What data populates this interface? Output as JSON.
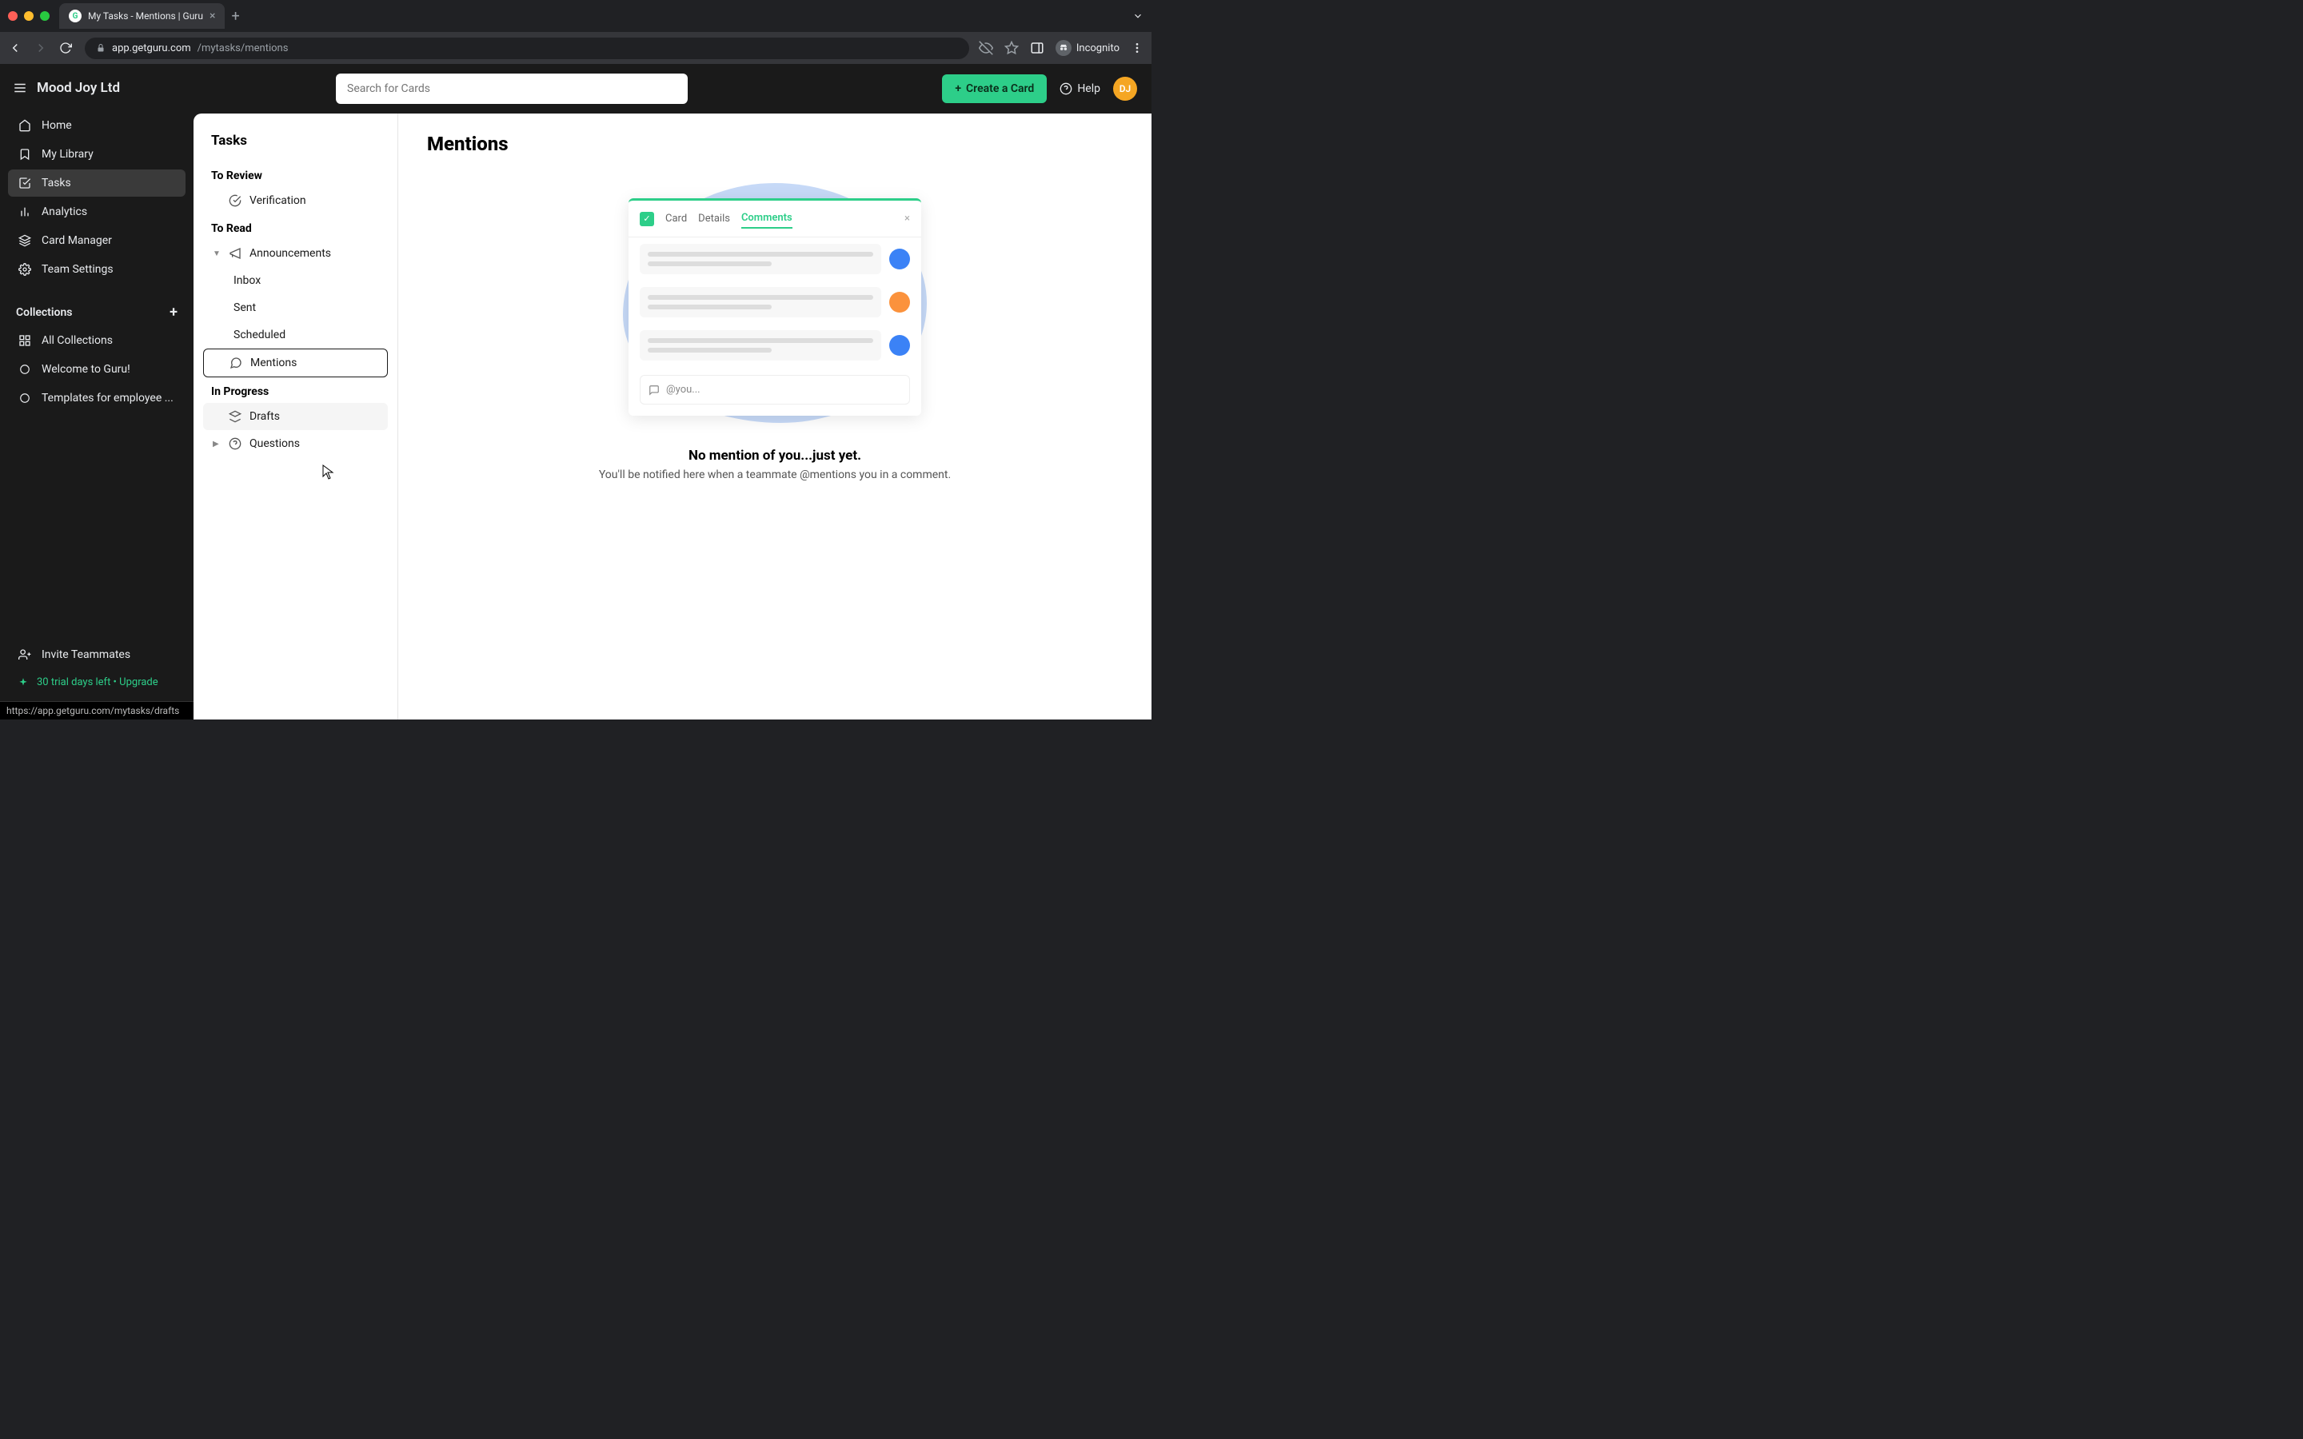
{
  "browser": {
    "tab_title": "My Tasks - Mentions | Guru",
    "url_host": "app.getguru.com",
    "url_path": "/mytasks/mentions",
    "incognito_label": "Incognito",
    "status_link": "https://app.getguru.com/mytasks/drafts"
  },
  "topbar": {
    "org_name": "Mood Joy Ltd",
    "search_placeholder": "Search for Cards",
    "create_label": "Create a Card",
    "help_label": "Help",
    "avatar_initials": "DJ"
  },
  "sidebar": {
    "items": [
      {
        "label": "Home",
        "icon": "home"
      },
      {
        "label": "My Library",
        "icon": "bookmark"
      },
      {
        "label": "Tasks",
        "icon": "check"
      },
      {
        "label": "Analytics",
        "icon": "bars"
      },
      {
        "label": "Card Manager",
        "icon": "stack"
      },
      {
        "label": "Team Settings",
        "icon": "gear"
      }
    ],
    "collections_title": "Collections",
    "collections": [
      {
        "label": "All Collections",
        "icon": "grid"
      },
      {
        "label": "Welcome to Guru!",
        "icon": "circle"
      },
      {
        "label": "Templates for employee ...",
        "icon": "circle"
      }
    ],
    "footer": {
      "invite_label": "Invite Teammates",
      "trial_label": "30 trial days left • Upgrade"
    }
  },
  "tasks_panel": {
    "title": "Tasks",
    "sections": {
      "to_review": {
        "title": "To Review",
        "items": [
          {
            "label": "Verification",
            "icon": "verify"
          }
        ]
      },
      "to_read": {
        "title": "To Read",
        "announcements": {
          "label": "Announcements",
          "children": [
            {
              "label": "Inbox"
            },
            {
              "label": "Sent"
            },
            {
              "label": "Scheduled"
            }
          ]
        },
        "mentions": {
          "label": "Mentions"
        }
      },
      "in_progress": {
        "title": "In Progress",
        "items": [
          {
            "label": "Drafts"
          },
          {
            "label": "Questions"
          }
        ]
      }
    }
  },
  "main": {
    "title": "Mentions",
    "illustration": {
      "tabs": {
        "card": "Card",
        "details": "Details",
        "comments": "Comments"
      },
      "reply_placeholder": "@you..."
    },
    "empty_heading": "No mention of you...just yet.",
    "empty_body": "You'll be notified here when a teammate @mentions you in a comment."
  }
}
